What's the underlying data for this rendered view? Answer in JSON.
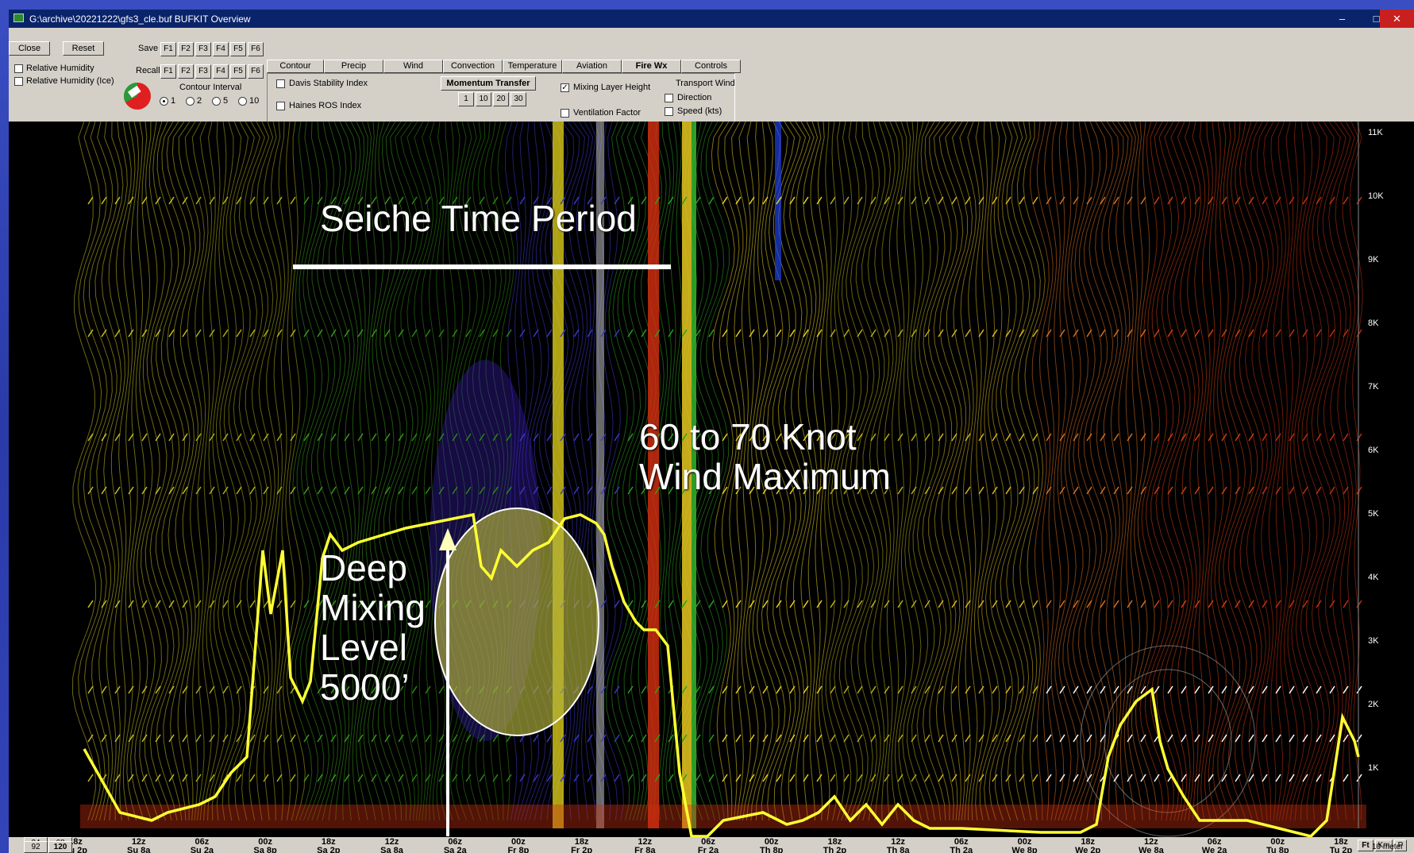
{
  "window": {
    "title": "G:\\archive\\20221222\\gfs3_cle.buf BUFKIT Overview",
    "minimize": "–",
    "maximize": "□",
    "close": "✕"
  },
  "toolbar": {
    "close_label": "Close",
    "reset_label": "Reset",
    "save_label": "Save",
    "recall_label": "Recall",
    "fkeys": [
      "F1",
      "F2",
      "F3",
      "F4",
      "F5",
      "F6"
    ],
    "rh_label": "Relative Humidity",
    "rh_ice_label": "Relative Humidity (Ice)",
    "contour_interval_label": "Contour Interval",
    "contour_options": [
      "1",
      "2",
      "5",
      "10"
    ],
    "contour_selected": "1"
  },
  "tabs": [
    "Contour",
    "Precip",
    "Wind",
    "Convection",
    "Temperature",
    "Aviation",
    "Fire Wx",
    "Controls"
  ],
  "active_tab": "Fire Wx",
  "firewx": {
    "davis": "Davis Stability Index",
    "haines": "Haines ROS Index",
    "momentum": "Momentum Transfer",
    "momentum_opts": [
      "1",
      "10",
      "20",
      "30"
    ],
    "mixing": "Mixing Layer Height",
    "mixing_checked": true,
    "ventilation": "Ventilation Factor",
    "transport": "Transport Wind",
    "direction": "Direction",
    "speed": "Speed (kts)"
  },
  "y_axis_labels": [
    "11K",
    "10K",
    "9K",
    "8K",
    "7K",
    "6K",
    "5K",
    "4K",
    "3K",
    "2K",
    "1K"
  ],
  "time_labels": [
    [
      "18z",
      "Su 2p"
    ],
    [
      "12z",
      "Su 8a"
    ],
    [
      "06z",
      "Su 2a"
    ],
    [
      "00z",
      "Sa 8p"
    ],
    [
      "18z",
      "Sa 2p"
    ],
    [
      "12z",
      "Sa 8a"
    ],
    [
      "06z",
      "Sa 2a"
    ],
    [
      "00z",
      "Fr 8p"
    ],
    [
      "18z",
      "Fr 2p"
    ],
    [
      "12z",
      "Fr 8a"
    ],
    [
      "06z",
      "Fr 2a"
    ],
    [
      "00z",
      "Th 8p"
    ],
    [
      "18z",
      "Th 2p"
    ],
    [
      "12z",
      "Th 8a"
    ],
    [
      "06z",
      "Th 2a"
    ],
    [
      "00z",
      "We 8p"
    ],
    [
      "18z",
      "We 2p"
    ],
    [
      "12z",
      "We 8a"
    ],
    [
      "06z",
      "We 2a"
    ],
    [
      "00z",
      "Tu 8p"
    ],
    [
      "18z",
      "Tu 2p"
    ]
  ],
  "bottom_left": {
    "a": "34",
    "b": "68",
    "c": "92",
    "d": "120"
  },
  "bottom_right": {
    "ft": "Ft",
    "km": "Km",
    "p": "P",
    "meter": "10 meter"
  },
  "annotations": {
    "seiche": "Seiche Time Period",
    "wind_max_1": "60 to 70 Knot",
    "wind_max_2": "Wind Maximum",
    "deep_1": "Deep",
    "deep_2": "Mixing",
    "deep_3": "Level",
    "deep_4": "5000’"
  },
  "colors": {
    "titlebar": "#0a246a",
    "mixing_line": "#ffff33",
    "ellipse_fill": "#b4b43c"
  }
}
